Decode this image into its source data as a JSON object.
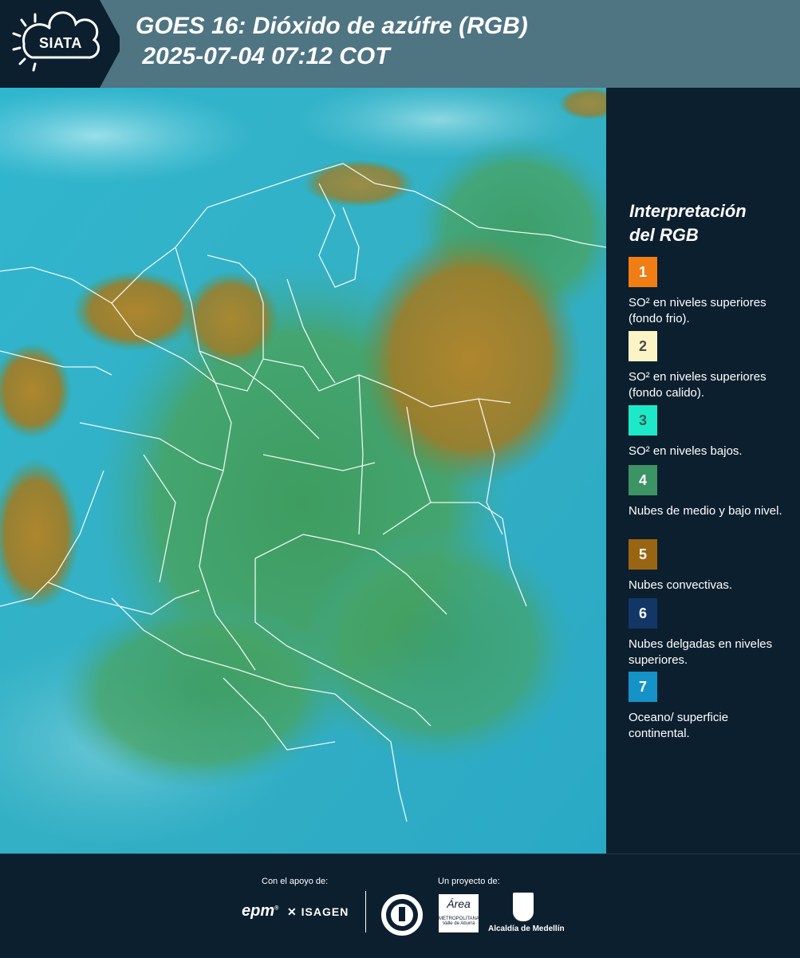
{
  "header": {
    "logo_text": "SIATA",
    "title_line1": "GOES 16: Dióxido de azúfre (RGB)",
    "title_line2": " 2025-07-04 07:12 COT"
  },
  "legend": {
    "title_line1": "Interpretación",
    "title_line2": "del RGB",
    "items": [
      {
        "number": "1",
        "color": "#f07e14",
        "text_color": "#ffffff",
        "label": "SO² en niveles superiores (fondo frio)."
      },
      {
        "number": "2",
        "color": "#fdf4c6",
        "text_color": "#4a4a4a",
        "label": "SO² en niveles superiores (fondo calido)."
      },
      {
        "number": "3",
        "color": "#1de9c8",
        "text_color": "#3a5a55",
        "label": "SO² en niveles bajos."
      },
      {
        "number": "4",
        "color": "#3c9364",
        "text_color": "#ffffff",
        "label": "Nubes de medio y bajo nivel."
      },
      {
        "number": "5",
        "color": "#9a6512",
        "text_color": "#ffffff",
        "label": "Nubes convectivas."
      },
      {
        "number": "6",
        "color": "#123766",
        "text_color": "#ffffff",
        "label": "Nubes delgadas en niveles superiores."
      },
      {
        "number": "7",
        "color": "#1592c8",
        "text_color": "#ffffff",
        "label": "Oceano/ superficie continental."
      }
    ]
  },
  "footer": {
    "support_label": "Con el apoyo de:",
    "project_label": "Un proyecto de:",
    "sponsor_epm": "epm",
    "sponsor_isagen": "ISAGEN",
    "area_logo_script": "Área",
    "area_logo_line1": "METROPOLITANA",
    "area_logo_line2": "Valle de Aburrá",
    "alcaldia": "Alcaldía de Medellín"
  }
}
